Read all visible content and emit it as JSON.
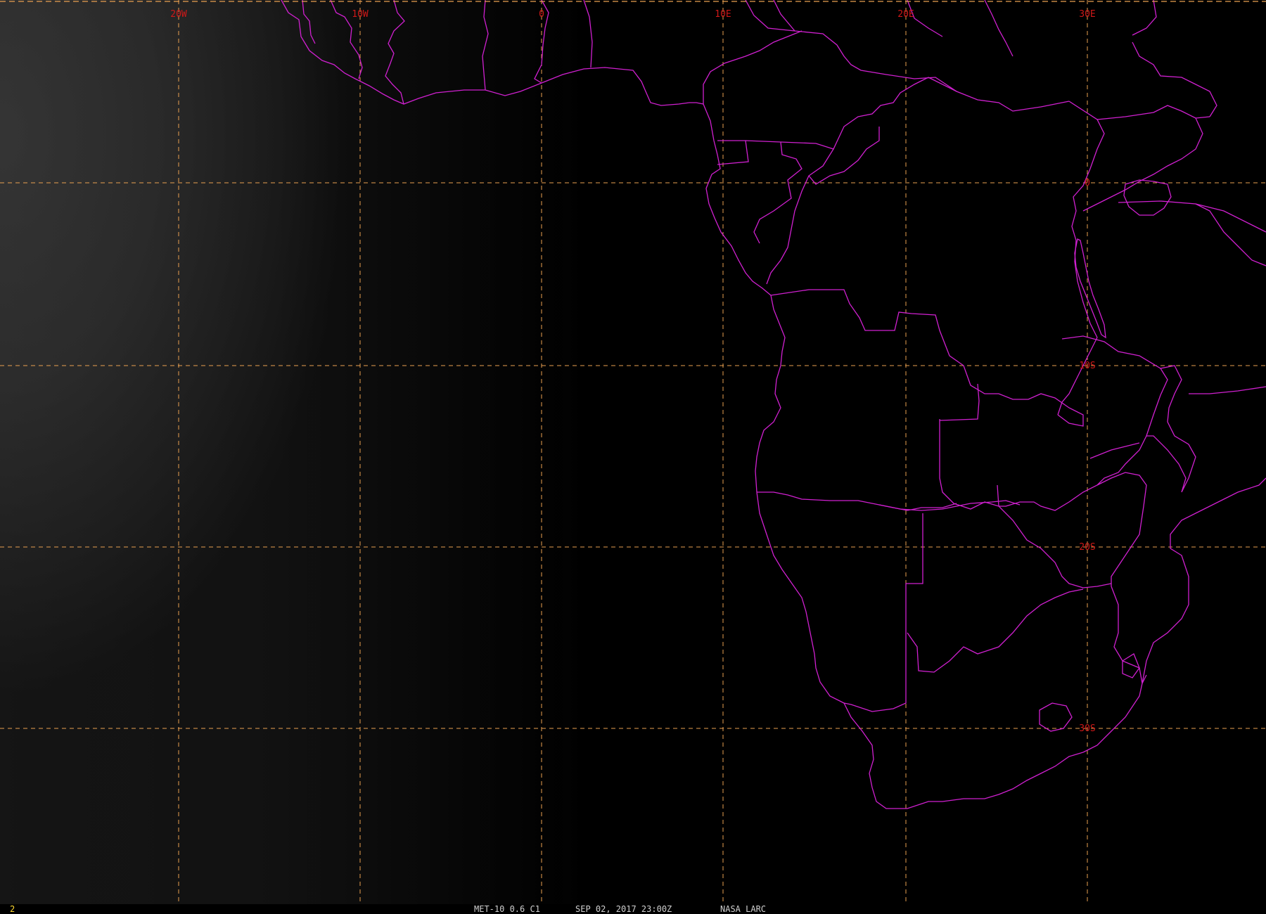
{
  "map": {
    "grid_color": "#e9a050",
    "coast_color": "#d020d0",
    "label_color": "#d01818",
    "frame_color": "#ffd830",
    "lon_labels": [
      "20W",
      "10W",
      "0",
      "10E",
      "20E",
      "30E"
    ],
    "lat_labels": [
      "0",
      "10S",
      "20S",
      "30S"
    ]
  },
  "status_bar": {
    "frame_number": "2",
    "satellite": "MET-10 0.6 C1",
    "datetime": "SEP 02, 2017 23:00Z",
    "source": "NASA LARC"
  }
}
